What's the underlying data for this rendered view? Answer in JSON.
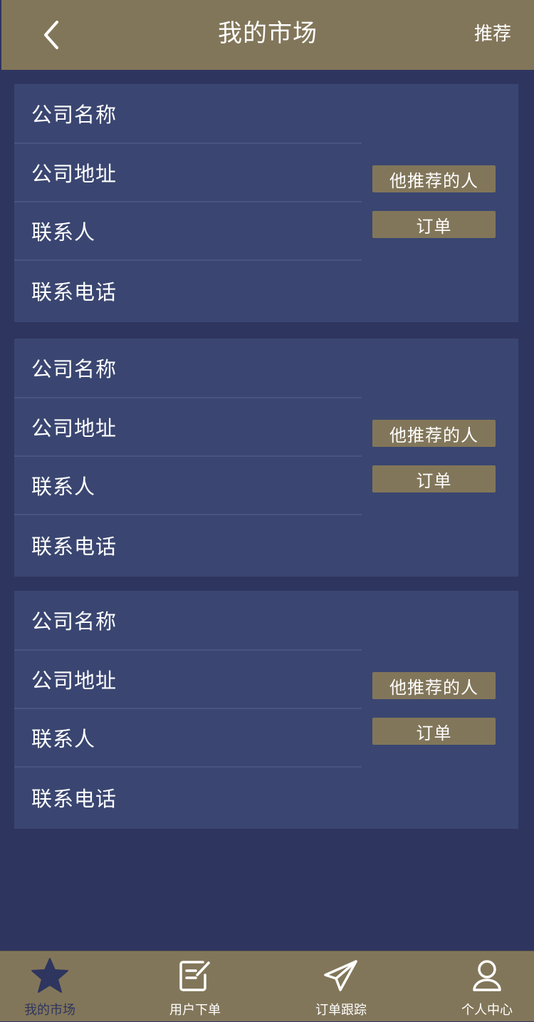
{
  "header": {
    "title": "我的市场",
    "right_action": "推荐"
  },
  "cards": [
    {
      "rows": [
        "公司名称",
        "公司地址",
        "联系人",
        "联系电话"
      ],
      "buttons": {
        "recommended": "他推荐的人",
        "orders": "订单"
      }
    },
    {
      "rows": [
        "公司名称",
        "公司地址",
        "联系人",
        "联系电话"
      ],
      "buttons": {
        "recommended": "他推荐的人",
        "orders": "订单"
      }
    },
    {
      "rows": [
        "公司名称",
        "公司地址",
        "联系人",
        "联系电话"
      ],
      "buttons": {
        "recommended": "他推荐的人",
        "orders": "订单"
      }
    }
  ],
  "tabbar": {
    "items": [
      {
        "label": "我的市场",
        "icon": "star-icon",
        "active": true
      },
      {
        "label": "用户下单",
        "icon": "edit-note-icon",
        "active": false
      },
      {
        "label": "订单跟踪",
        "icon": "paper-plane-icon",
        "active": false
      },
      {
        "label": "个人中心",
        "icon": "user-icon",
        "active": false
      }
    ]
  },
  "colors": {
    "background": "#2e355f",
    "card": "#3a4671",
    "accent": "#82765a",
    "active_tab": "#2e355f"
  }
}
